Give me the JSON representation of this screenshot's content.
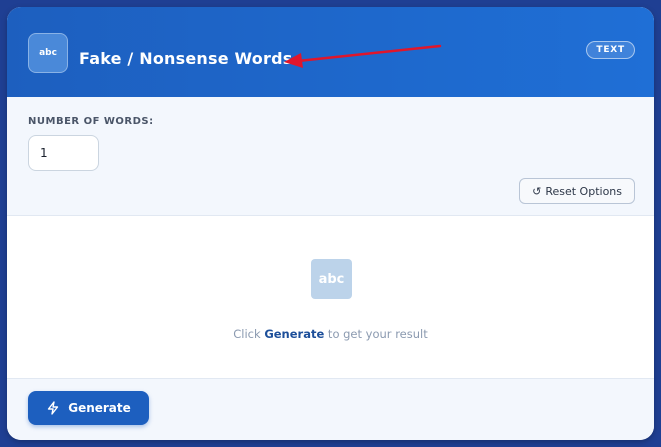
{
  "header": {
    "icon_text": "abc",
    "title": "Fake / Nonsense Words",
    "badge": "TEXT"
  },
  "options": {
    "label": "NUMBER OF WORDS:",
    "number_of_words": "1",
    "reset_glyph": "↺",
    "reset_label": "Reset Options"
  },
  "result": {
    "icon_text": "abc",
    "hint_before": "Click ",
    "hint_link": "Generate",
    "hint_after": " to get your result"
  },
  "footer": {
    "generate_label": "Generate"
  },
  "colors": {
    "header_blue": "#1d5fbf",
    "annotation_arrow": "#e0162b"
  }
}
